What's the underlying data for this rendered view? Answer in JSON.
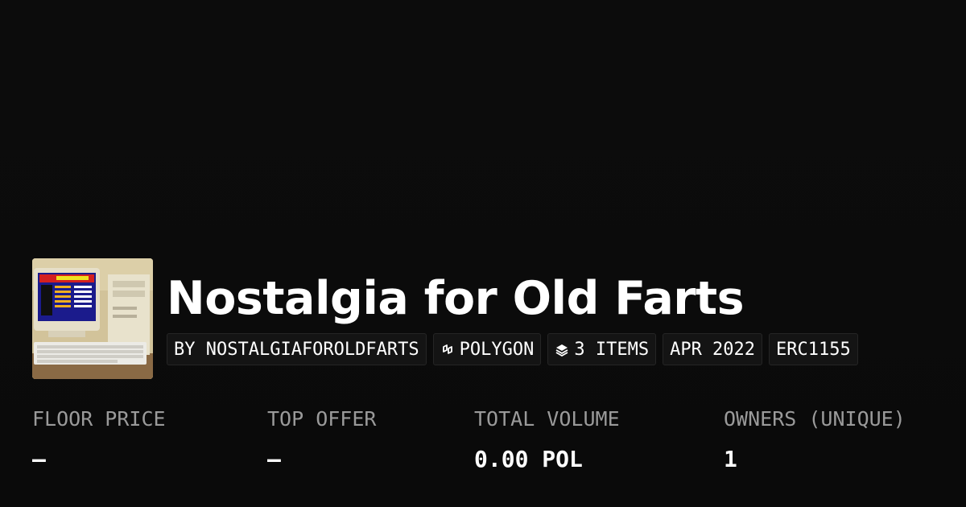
{
  "collection": {
    "title": "Nostalgia for Old Farts",
    "thumbnail_icon": "retro-computer-photo"
  },
  "tags": [
    {
      "label": "BY NOSTALGIAFOROLDFARTS",
      "icon": null
    },
    {
      "label": "POLYGON",
      "icon": "polygon-chain-icon"
    },
    {
      "label": "3 ITEMS",
      "icon": "stack-layers-icon"
    },
    {
      "label": "APR 2022",
      "icon": null
    },
    {
      "label": "ERC1155",
      "icon": null
    }
  ],
  "stats": [
    {
      "label": "FLOOR PRICE",
      "value": "–"
    },
    {
      "label": "TOP OFFER",
      "value": "–"
    },
    {
      "label": "TOTAL VOLUME",
      "value": "0.00 POL"
    },
    {
      "label": "OWNERS (UNIQUE)",
      "value": "1"
    }
  ],
  "colors": {
    "background": "#0b0b0b",
    "text": "#ffffff",
    "muted": "#9a9a9a",
    "tag_bg": "#141414"
  }
}
